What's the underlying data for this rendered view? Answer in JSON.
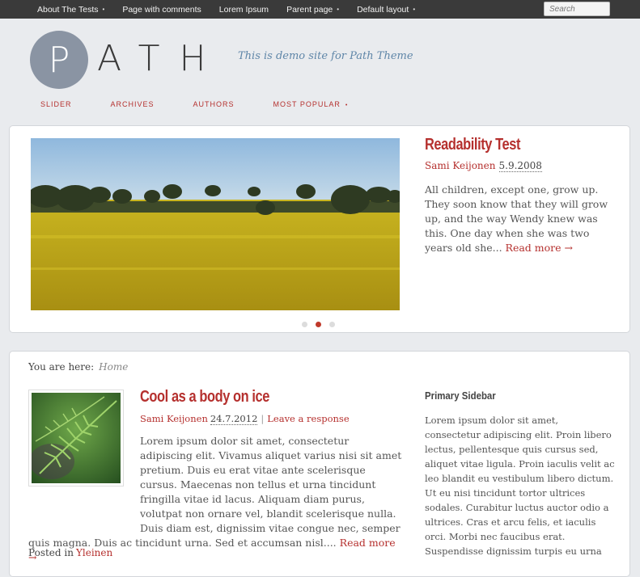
{
  "topnav": {
    "items": [
      {
        "label": "About The Tests",
        "has_children": true
      },
      {
        "label": "Page with comments",
        "has_children": false
      },
      {
        "label": "Lorem Ipsum",
        "has_children": false
      },
      {
        "label": "Parent page",
        "has_children": true
      },
      {
        "label": "Default layout",
        "has_children": true
      }
    ],
    "dot": "•",
    "search_placeholder": "Search"
  },
  "header": {
    "logo_first": "P",
    "logo_rest": "ATH",
    "tagline": "This is demo site for Path Theme",
    "logo_circle_color": "#8a94a3"
  },
  "mainnav": {
    "items": [
      {
        "label": "Slider"
      },
      {
        "label": "Archives"
      },
      {
        "label": "Authors"
      },
      {
        "label": "Most Popular"
      }
    ],
    "dot": "•"
  },
  "slider": {
    "title": "Readability Test",
    "author": "Sami Keijonen",
    "date": "5.9.2008",
    "excerpt": "All children, except one, grow up. They soon know that they will grow up, and the way Wendy knew was this. One day when she was two years old she...",
    "read_more": "Read more →",
    "dots": [
      false,
      true,
      false
    ]
  },
  "content": {
    "breadcrumb_label": "You are here:",
    "breadcrumb_home": "Home",
    "post": {
      "title": "Cool as a body on ice",
      "author": "Sami Keijonen",
      "date": "24.7.2012",
      "separator": "|",
      "respond": "Leave a response",
      "body": "Lorem ipsum dolor sit amet, consectetur adipiscing elit. Vivamus aliquet varius nisi sit amet pretium. Duis eu erat vitae ante scelerisque cursus. Maecenas non tellus et urna tincidunt fringilla vitae id lacus. Aliquam diam purus, volutpat non ornare vel, blandit scelerisque nulla. Duis diam est, dignissim vitae congue nec, semper quis magna. Duis ac tincidunt urna. Sed et accumsan nisl....",
      "read_more": "Read more →",
      "posted_in_label": "Posted in",
      "category": "Yleinen"
    },
    "sidebar": {
      "title": "Primary Sidebar",
      "text": "Lorem ipsum dolor sit amet, consectetur adipiscing elit. Proin libero lectus, pellentesque quis cursus sed, aliquet vitae ligula. Proin iaculis velit ac leo blandit eu vestibulum libero dictum. Ut eu nisi tincidunt tortor ultrices sodales. Curabitur luctus auctor odio a ultrices. Cras et arcu felis, et iaculis orci. Morbi nec faucibus erat. Suspendisse dignissim turpis eu urna"
    }
  },
  "colors": {
    "accent": "#b5302e",
    "topbar": "#3a3a3a",
    "background": "#e9ebee",
    "tagline": "#5f86a8"
  }
}
